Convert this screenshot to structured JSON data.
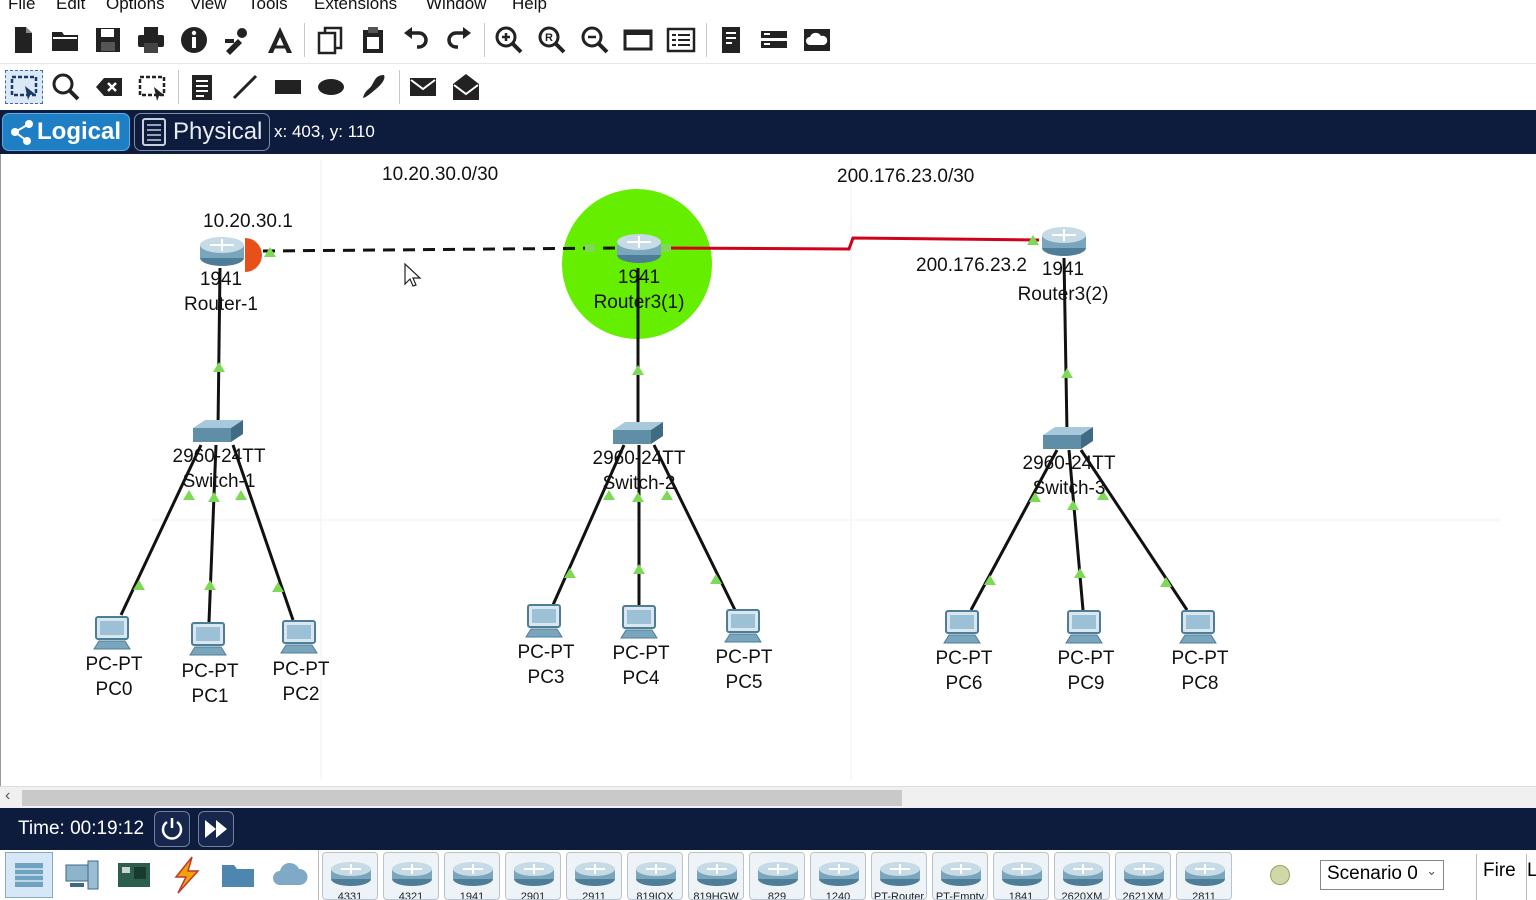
{
  "menu": [
    "File",
    "Edit",
    "Options",
    "View",
    "Tools",
    "Extensions",
    "Window",
    "Help"
  ],
  "toolbar1_icons": [
    "new-file-icon",
    "open-folder-icon",
    "save-icon",
    "print-icon",
    "info-icon",
    "network-wizard-icon",
    "activity-wizard-icon",
    "copy-icon",
    "paste-icon",
    "undo-icon",
    "redo-icon",
    "zoom-in-icon",
    "zoom-reset-icon",
    "zoom-out-icon",
    "drawing-palette-icon",
    "custom-devices-icon",
    "pdu-list-icon",
    "wan-icon",
    "cloud-icon"
  ],
  "toolbar2_icons": [
    "select-icon",
    "inspect-icon",
    "delete-icon",
    "resize-icon",
    "note-icon",
    "line-icon",
    "rectangle-icon",
    "ellipse-icon",
    "freeform-icon",
    "simple-pdu-icon",
    "complex-pdu-icon"
  ],
  "viewbar": {
    "logical_label": "Logical",
    "physical_label": "Physical",
    "coords": "x: 403, y: 110"
  },
  "network_labels": {
    "net1": "10.20.30.0/30",
    "net2": "200.176.23.0/30",
    "ip1": "10.20.30.1",
    "ip2": "200.176.23.2"
  },
  "devices": {
    "router1": {
      "model": "1941",
      "name": "Router-1"
    },
    "router2": {
      "model": "1941",
      "name": "Router3(1)"
    },
    "router3": {
      "model": "1941",
      "name": "Router3(2)"
    },
    "switch1": {
      "model": "2960-24TT",
      "name": "Switch-1"
    },
    "switch2": {
      "model": "2960-24TT",
      "name": "Switch-2"
    },
    "switch3": {
      "model": "2960-24TT",
      "name": "Switch-3"
    },
    "pc0": {
      "model": "PC-PT",
      "name": "PC0"
    },
    "pc1": {
      "model": "PC-PT",
      "name": "PC1"
    },
    "pc2": {
      "model": "PC-PT",
      "name": "PC2"
    },
    "pc3": {
      "model": "PC-PT",
      "name": "PC3"
    },
    "pc4": {
      "model": "PC-PT",
      "name": "PC4"
    },
    "pc5": {
      "model": "PC-PT",
      "name": "PC5"
    },
    "pc6": {
      "model": "PC-PT",
      "name": "PC6"
    },
    "pc9": {
      "model": "PC-PT",
      "name": "PC9"
    },
    "pc8": {
      "model": "PC-PT",
      "name": "PC8"
    }
  },
  "timebar": {
    "time": "Time: 00:19:12"
  },
  "palette": {
    "categories": [
      "network-devices-icon",
      "end-devices-icon",
      "components-icon",
      "connections-icon",
      "misc-icon",
      "multiuser-icon"
    ],
    "models": [
      "4331",
      "4321",
      "1941",
      "2901",
      "2911",
      "819IOX",
      "819HGW",
      "829",
      "1240",
      "PT-Router",
      "PT-Empty",
      "1841",
      "2620XM",
      "2621XM",
      "2811"
    ],
    "scenario": "Scenario 0",
    "fire_label": "Fire",
    "last_col": "L"
  },
  "colors": {
    "viewbar_bg": "#0d1b3d",
    "logical_tab": "#1e7fc4",
    "link_up": "#7ed957",
    "serial_link": "#d0021b",
    "highlight": "#66ee00"
  }
}
